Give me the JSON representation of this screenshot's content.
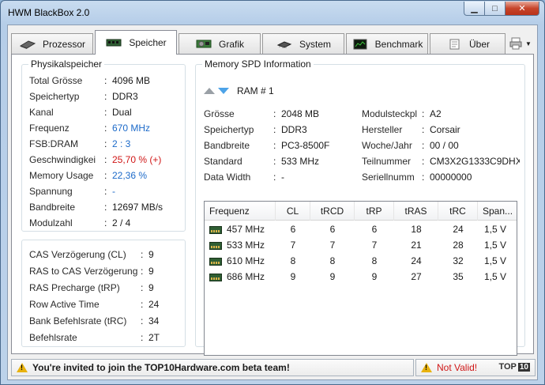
{
  "window": {
    "title": "HWM BlackBox 2.0"
  },
  "tabs": [
    {
      "label": "Prozessor",
      "icon": "cpu-chip-icon"
    },
    {
      "label": "Speicher",
      "icon": "ram-module-icon"
    },
    {
      "label": "Grafik",
      "icon": "graphics-card-icon"
    },
    {
      "label": "System",
      "icon": "chipset-icon"
    },
    {
      "label": "Benchmark",
      "icon": "benchmark-chart-icon"
    },
    {
      "label": "Über",
      "icon": "about-document-icon"
    }
  ],
  "active_tab": "Speicher",
  "physikalspeicher": {
    "title": "Physikalspeicher",
    "rows": [
      {
        "label": "Total Grösse",
        "value": "4096 MB",
        "color": "normal"
      },
      {
        "label": "Speichertyp",
        "value": "DDR3",
        "color": "normal"
      },
      {
        "label": "Kanal",
        "value": "Dual",
        "color": "normal"
      },
      {
        "label": "Frequenz",
        "value": "670 MHz",
        "color": "blue"
      },
      {
        "label": "FSB:DRAM",
        "value": "2 : 3",
        "color": "blue"
      },
      {
        "label": "Geschwindigkei",
        "value": "25,70 % (+)",
        "color": "red"
      },
      {
        "label": "Memory Usage",
        "value": "22,36 %",
        "color": "blue"
      },
      {
        "label": "Spannung",
        "value": "-",
        "color": "blue"
      },
      {
        "label": "Bandbreite",
        "value": "12697 MB/s",
        "color": "normal"
      },
      {
        "label": "Modulzahl",
        "value": "2  /  4",
        "color": "normal"
      }
    ]
  },
  "timings": {
    "rows": [
      {
        "label": "CAS Verzögerung (CL)",
        "value": "9"
      },
      {
        "label": "RAS to CAS Verzögerung",
        "value": "9"
      },
      {
        "label": "RAS Precharge (tRP)",
        "value": "9"
      },
      {
        "label": "Row Active Time",
        "value": "24"
      },
      {
        "label": "Bank Befehlsrate (tRC)",
        "value": "34"
      },
      {
        "label": "Befehlsrate",
        "value": "2T"
      }
    ]
  },
  "spd": {
    "title": "Memory SPD Information",
    "module_label": "RAM # 1",
    "left": [
      {
        "label": "Grösse",
        "value": "2048 MB"
      },
      {
        "label": "Speichertyp",
        "value": "DDR3"
      },
      {
        "label": "Bandbreite",
        "value": "PC3-8500F"
      },
      {
        "label": "Standard",
        "value": "533 MHz"
      },
      {
        "label": "Data Width",
        "value": "-"
      }
    ],
    "right": [
      {
        "label": "Modulsteckpl",
        "value": "A2"
      },
      {
        "label": "Hersteller",
        "value": "Corsair"
      },
      {
        "label": "Woche/Jahr",
        "value": "00 / 00"
      },
      {
        "label": "Teilnummer",
        "value": "CM3X2G1333C9DHX"
      },
      {
        "label": "Seriellnumm",
        "value": "00000000"
      }
    ],
    "table": {
      "headers": [
        "Frequenz",
        "CL",
        "tRCD",
        "tRP",
        "tRAS",
        "tRC",
        "Span..."
      ],
      "rows": [
        [
          "457 MHz",
          "6",
          "6",
          "6",
          "18",
          "24",
          "1,5 V"
        ],
        [
          "533 MHz",
          "7",
          "7",
          "7",
          "21",
          "28",
          "1,5 V"
        ],
        [
          "610 MHz",
          "8",
          "8",
          "8",
          "24",
          "32",
          "1,5 V"
        ],
        [
          "686 MHz",
          "9",
          "9",
          "9",
          "27",
          "35",
          "1,5 V"
        ]
      ]
    }
  },
  "status": {
    "message": "You're invited to join the TOP10Hardware.com beta team!",
    "validity": "Not Valid!",
    "logo_text": "TOP",
    "logo_badge": "10"
  },
  "colors": {
    "blue": "#1c6ac9",
    "red": "#d01717",
    "warning": "#e8b20e"
  }
}
